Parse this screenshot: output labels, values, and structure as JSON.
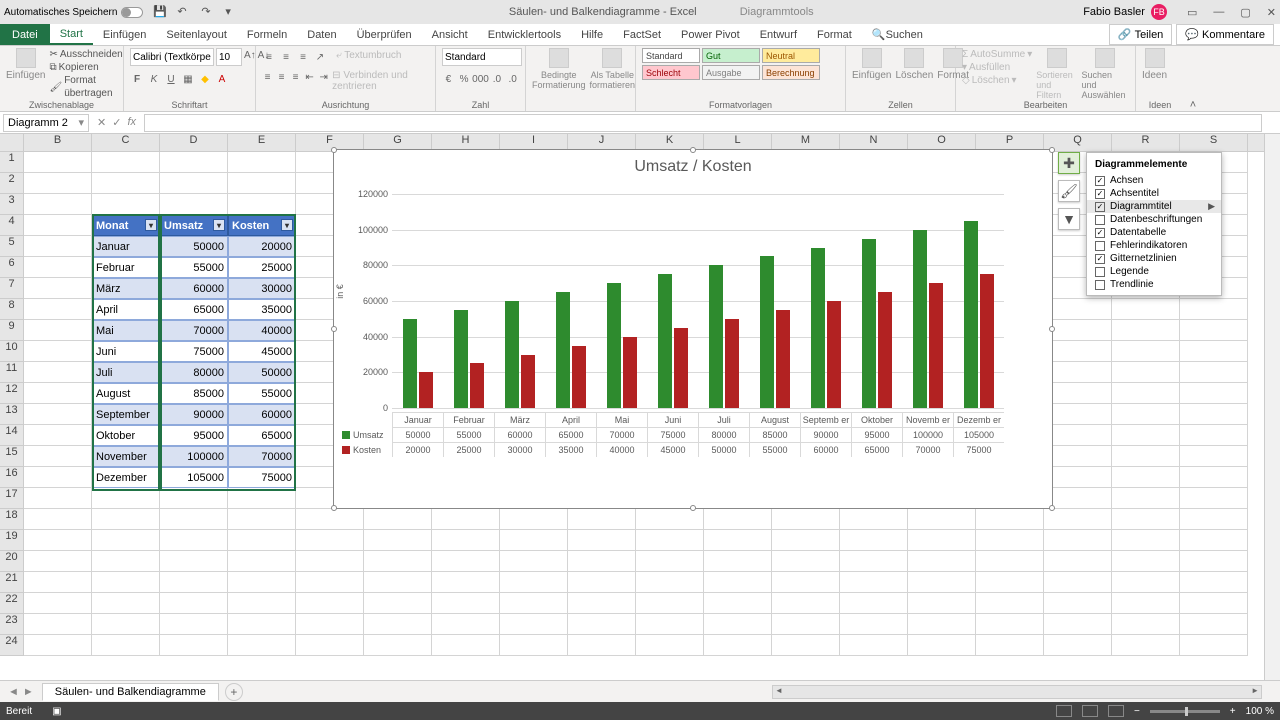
{
  "titlebar": {
    "autosave": "Automatisches Speichern",
    "doc_title": "Säulen- und Balkendiagramme - Excel",
    "tool_tab": "Diagrammtools",
    "user": "Fabio Basler",
    "user_initials": "FB"
  },
  "tabs": {
    "file": "Datei",
    "items": [
      "Start",
      "Einfügen",
      "Seitenlayout",
      "Formeln",
      "Daten",
      "Überprüfen",
      "Ansicht",
      "Entwicklertools",
      "Hilfe",
      "FactSet",
      "Power Pivot",
      "Entwurf",
      "Format"
    ],
    "search": "Suchen",
    "share": "Teilen",
    "comments": "Kommentare"
  },
  "ribbon": {
    "clipboard": {
      "label": "Zwischenablage",
      "cut": "Ausschneiden",
      "copy": "Kopieren",
      "brush": "Format übertragen",
      "paste": "Einfügen"
    },
    "font": {
      "label": "Schriftart",
      "name": "Calibri (Textkörpe",
      "size": "10"
    },
    "align": {
      "label": "Ausrichtung",
      "wrap": "Textumbruch",
      "merge": "Verbinden und zentrieren"
    },
    "number": {
      "label": "Zahl",
      "format": "Standard"
    },
    "condfmt": {
      "a": "Bedingte Formatierung",
      "b": "Als Tabelle formatieren"
    },
    "styles": {
      "label": "Formatvorlagen",
      "std": "Standard",
      "gut": "Gut",
      "neu": "Neutral",
      "sch": "Schlecht",
      "aus": "Ausgabe",
      "ber": "Berechnung"
    },
    "cells": {
      "label": "Zellen",
      "ins": "Einfügen",
      "del": "Löschen",
      "fmt": "Format"
    },
    "editing": {
      "label": "Bearbeiten",
      "sum": "AutoSumme",
      "fill": "Ausfüllen",
      "clear": "Löschen",
      "sort": "Sortieren und Filtern",
      "find": "Suchen und Auswählen"
    },
    "ideas": {
      "label": "Ideen",
      "btn": "Ideen"
    }
  },
  "namebox": "Diagramm 2",
  "columns": [
    "B",
    "C",
    "D",
    "E",
    "F",
    "G",
    "H",
    "I",
    "J",
    "K",
    "L",
    "M",
    "N",
    "O",
    "P",
    "Q",
    "R",
    "S"
  ],
  "table": {
    "headers": [
      "Monat",
      "Umsatz",
      "Kosten"
    ],
    "rows": [
      [
        "Januar",
        "50000",
        "20000"
      ],
      [
        "Februar",
        "55000",
        "25000"
      ],
      [
        "März",
        "60000",
        "30000"
      ],
      [
        "April",
        "65000",
        "35000"
      ],
      [
        "Mai",
        "70000",
        "40000"
      ],
      [
        "Juni",
        "75000",
        "45000"
      ],
      [
        "Juli",
        "80000",
        "50000"
      ],
      [
        "August",
        "85000",
        "55000"
      ],
      [
        "September",
        "90000",
        "60000"
      ],
      [
        "Oktober",
        "95000",
        "65000"
      ],
      [
        "November",
        "100000",
        "70000"
      ],
      [
        "Dezember",
        "105000",
        "75000"
      ]
    ]
  },
  "chart_data": {
    "type": "bar",
    "title": "Umsatz / Kosten",
    "ylabel": "in €",
    "ylim": [
      0,
      120000
    ],
    "yticks": [
      0,
      20000,
      40000,
      60000,
      80000,
      100000,
      120000
    ],
    "categories": [
      "Januar",
      "Februar",
      "März",
      "April",
      "Mai",
      "Juni",
      "Juli",
      "August",
      "September",
      "Oktober",
      "November",
      "Dezember"
    ],
    "categories_short": [
      "Januar",
      "Februar",
      "März",
      "April",
      "Mai",
      "Juni",
      "Juli",
      "August",
      "Septemb er",
      "Oktober",
      "Novemb er",
      "Dezemb er"
    ],
    "series": [
      {
        "name": "Umsatz",
        "color": "#2e8b2e",
        "values": [
          50000,
          55000,
          60000,
          65000,
          70000,
          75000,
          80000,
          85000,
          90000,
          95000,
          100000,
          105000
        ]
      },
      {
        "name": "Kosten",
        "color": "#b22222",
        "values": [
          20000,
          25000,
          30000,
          35000,
          40000,
          45000,
          50000,
          55000,
          60000,
          65000,
          70000,
          75000
        ]
      }
    ]
  },
  "chart_elements": {
    "title": "Diagrammelemente",
    "items": [
      {
        "label": "Achsen",
        "checked": true
      },
      {
        "label": "Achsentitel",
        "checked": true
      },
      {
        "label": "Diagrammtitel",
        "checked": true,
        "arrow": true,
        "hover": true
      },
      {
        "label": "Datenbeschriftungen",
        "checked": false
      },
      {
        "label": "Datentabelle",
        "checked": true
      },
      {
        "label": "Fehlerindikatoren",
        "checked": false
      },
      {
        "label": "Gitternetzlinien",
        "checked": true
      },
      {
        "label": "Legende",
        "checked": false
      },
      {
        "label": "Trendlinie",
        "checked": false
      }
    ]
  },
  "sheet": {
    "name": "Säulen- und Balkendiagramme"
  },
  "status": {
    "ready": "Bereit",
    "zoom": "100 %"
  }
}
